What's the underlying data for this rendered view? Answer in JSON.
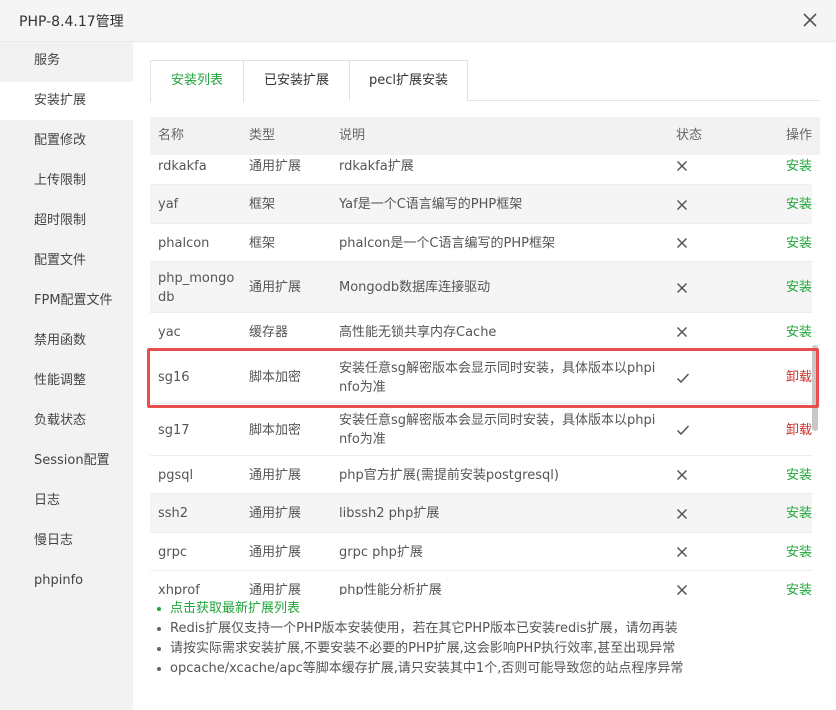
{
  "window": {
    "title": "PHP-8.4.17管理"
  },
  "sidebar": {
    "items": [
      {
        "label": "服务"
      },
      {
        "label": "安装扩展"
      },
      {
        "label": "配置修改"
      },
      {
        "label": "上传限制"
      },
      {
        "label": "超时限制"
      },
      {
        "label": "配置文件"
      },
      {
        "label": "FPM配置文件"
      },
      {
        "label": "禁用函数"
      },
      {
        "label": "性能调整"
      },
      {
        "label": "负载状态"
      },
      {
        "label": "Session配置"
      },
      {
        "label": "日志"
      },
      {
        "label": "慢日志"
      },
      {
        "label": "phpinfo"
      }
    ],
    "active_index": 1
  },
  "tabs": {
    "items": [
      {
        "label": "安装列表"
      },
      {
        "label": "已安装扩展"
      },
      {
        "label": "pecl扩展安装"
      }
    ],
    "active_index": 0
  },
  "table": {
    "headers": {
      "name": "名称",
      "type": "类型",
      "desc": "说明",
      "status": "状态",
      "op": "操作"
    },
    "rows": [
      {
        "name": "rdkakfa",
        "type": "通用扩展",
        "desc": "rdkakfa扩展",
        "status": "✕",
        "op": "安装",
        "installed": false
      },
      {
        "name": "yaf",
        "type": "框架",
        "desc": "Yaf是一个C语言编写的PHP框架",
        "status": "✕",
        "op": "安装",
        "installed": false
      },
      {
        "name": "phalcon",
        "type": "框架",
        "desc": "phalcon是一个C语言编写的PHP框架",
        "status": "✕",
        "op": "安装",
        "installed": false
      },
      {
        "name": "php_mongodb",
        "type": "通用扩展",
        "desc": "Mongodb数据库连接驱动",
        "status": "✕",
        "op": "安装",
        "installed": false
      },
      {
        "name": "yac",
        "type": "缓存器",
        "desc": "高性能无锁共享内存Cache",
        "status": "✕",
        "op": "安装",
        "installed": false
      },
      {
        "name": "sg16",
        "type": "脚本加密",
        "desc": "安装任意sg解密版本会显示同时安装，具体版本以phpinfo为准",
        "status": "✓",
        "op": "卸载",
        "installed": true
      },
      {
        "name": "sg17",
        "type": "脚本加密",
        "desc": "安装任意sg解密版本会显示同时安装，具体版本以phpinfo为准",
        "status": "✓",
        "op": "卸载",
        "installed": true
      },
      {
        "name": "pgsql",
        "type": "通用扩展",
        "desc": "php官方扩展(需提前安装postgresql)",
        "status": "✕",
        "op": "安装",
        "installed": false
      },
      {
        "name": "ssh2",
        "type": "通用扩展",
        "desc": "libssh2 php扩展",
        "status": "✕",
        "op": "安装",
        "installed": false
      },
      {
        "name": "grpc",
        "type": "通用扩展",
        "desc": "grpc php扩展",
        "status": "✕",
        "op": "安装",
        "installed": false
      },
      {
        "name": "xhprof",
        "type": "通用扩展",
        "desc": "php性能分析扩展",
        "status": "✕",
        "op": "安装",
        "installed": false
      }
    ]
  },
  "notes": [
    {
      "text": "点击获取最新扩展列表",
      "link": true
    },
    {
      "text": "Redis扩展仅支持一个PHP版本安装使用，若在其它PHP版本已安装redis扩展，请勿再装",
      "link": false
    },
    {
      "text": "请按实际需求安装扩展,不要安装不必要的PHP扩展,这会影响PHP执行效率,甚至出现异常",
      "link": false
    },
    {
      "text": "opcache/xcache/apc等脚本缓存扩展,请只安装其中1个,否则可能导致您的站点程序异常",
      "link": false
    }
  ],
  "colors": {
    "accent": "#20a53a",
    "uninstall": "#c9302c",
    "highlight": "#e94e4e"
  }
}
